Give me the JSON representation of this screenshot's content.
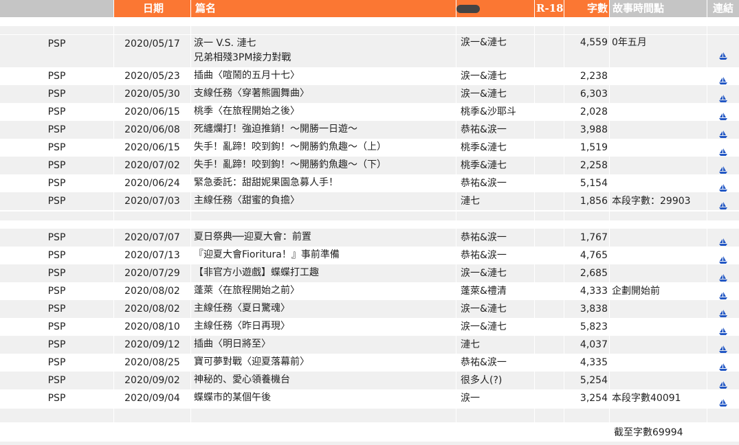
{
  "header": {
    "platform": "",
    "date": "日期",
    "title": "篇名",
    "characters": "",
    "r18": "R-18",
    "word_count": "字數",
    "story_time": "故事時間點",
    "link": "連結"
  },
  "colors": {
    "header_orange": "#fb7733",
    "header_gray": "#c5c5c5",
    "row_odd": "#f0f0f0",
    "row_even": "#ffffff",
    "link_blue": "#2257c4"
  },
  "section1": [
    {
      "platform": "PSP",
      "date": "2020/05/17",
      "title1": "涙一 V.S. 漣七",
      "title2": "兄弟相殘3PM接力對戰",
      "chars": "涙一&漣七",
      "count": "4,559",
      "time": "0年五月",
      "link": "ship-icon"
    },
    {
      "platform": "PSP",
      "date": "2020/05/23",
      "title1": "插曲〈喧鬧的五月十七〉",
      "chars": "涙一&漣七",
      "count": "2,238",
      "time": "",
      "link": "ship-icon"
    },
    {
      "platform": "PSP",
      "date": "2020/05/30",
      "title1": "支線任務〈穿著熊圓舞曲〉",
      "chars": "涙一&漣七",
      "count": "6,303",
      "time": "",
      "link": "ship-icon"
    },
    {
      "platform": "PSP",
      "date": "2020/06/15",
      "title1": "桃季〈在旅程開始之後〉",
      "chars": "桃季&沙耶斗",
      "count": "2,028",
      "time": "",
      "link": "ship-icon"
    },
    {
      "platform": "PSP",
      "date": "2020/06/08",
      "title1": "死纏爛打！強迫推銷！～開勝一日遊～",
      "chars": "恭祐&涙一",
      "count": "3,988",
      "time": "",
      "link": "ship-icon"
    },
    {
      "platform": "PSP",
      "date": "2020/06/15",
      "title1": "失手！亂蹄！咬到鉤！～開勝釣魚趣～（上）",
      "chars": "桃季&漣七",
      "count": "1,519",
      "time": "",
      "link": "ship-icon"
    },
    {
      "platform": "PSP",
      "date": "2020/07/02",
      "title1": "失手！亂蹄！咬到鉤！～開勝釣魚趣～（下）",
      "chars": "桃季&漣七",
      "count": "2,258",
      "time": "",
      "link": "ship-icon"
    },
    {
      "platform": "PSP",
      "date": "2020/06/24",
      "title1": "緊急委託：甜甜妮果園急募人手！",
      "chars": "恭祐&涙一",
      "count": "5,154",
      "time": "",
      "link": "ship-icon"
    },
    {
      "platform": "PSP",
      "date": "2020/07/03",
      "title1": "主線任務〈甜蜜的負擔〉",
      "chars": "漣七",
      "count": "1,856",
      "time": "本段字數：29903",
      "link": "ship-icon"
    }
  ],
  "section2": [
    {
      "platform": "PSP",
      "date": "2020/07/07",
      "title1": "夏日祭典──迎夏大會：前置",
      "chars": "恭祐&涙一",
      "count": "1,767",
      "time": "",
      "link": "ship-icon"
    },
    {
      "platform": "PSP",
      "date": "2020/07/13",
      "title1": "『迎夏大會Fioritura！』事前準備",
      "chars": "恭祐&涙一",
      "count": "4,765",
      "time": "",
      "link": "ship-icon"
    },
    {
      "platform": "PSP",
      "date": "2020/07/29",
      "title1": "【非官方小遊戲】蝶蝶打工趣",
      "chars": "涙一&漣七",
      "count": "2,685",
      "time": "",
      "link": "ship-icon"
    },
    {
      "platform": "PSP",
      "date": "2020/08/02",
      "title1": "蓬萊〈在旅程開始之前〉",
      "chars": "蓬萊&禮清",
      "count": "4,333",
      "time": "企劃開始前",
      "link": "ship-icon"
    },
    {
      "platform": "PSP",
      "date": "2020/08/02",
      "title1": "主線任務〈夏日驚魂〉",
      "chars": "涙一&漣七",
      "count": "3,838",
      "time": "",
      "link": "ship-icon"
    },
    {
      "platform": "PSP",
      "date": "2020/08/10",
      "title1": "主線任務〈昨日再現〉",
      "chars": "涙一&漣七",
      "count": "5,823",
      "time": "",
      "link": "ship-icon"
    },
    {
      "platform": "PSP",
      "date": "2020/09/12",
      "title1": "插曲〈明日將至〉",
      "chars": "漣七",
      "count": "4,037",
      "time": "",
      "link": "ship-icon"
    },
    {
      "platform": "PSP",
      "date": "2020/08/25",
      "title1": "寶可夢對戰〈迎夏落幕前〉",
      "chars": "恭祐&涙一",
      "count": "4,335",
      "time": "",
      "link": "ship-icon"
    },
    {
      "platform": "PSP",
      "date": "2020/09/02",
      "title1": "神秘的、愛心領養機台",
      "chars": "很多人(?)",
      "count": "5,254",
      "time": "",
      "link": "ship-icon"
    },
    {
      "platform": "PSP",
      "date": "2020/09/04",
      "title1": "蝶蝶市的某個午後",
      "chars": "涙一",
      "count": "3,254",
      "time": "本段字數40091",
      "link": "ship-icon"
    }
  ],
  "footer": {
    "total": "截至字數69994"
  }
}
